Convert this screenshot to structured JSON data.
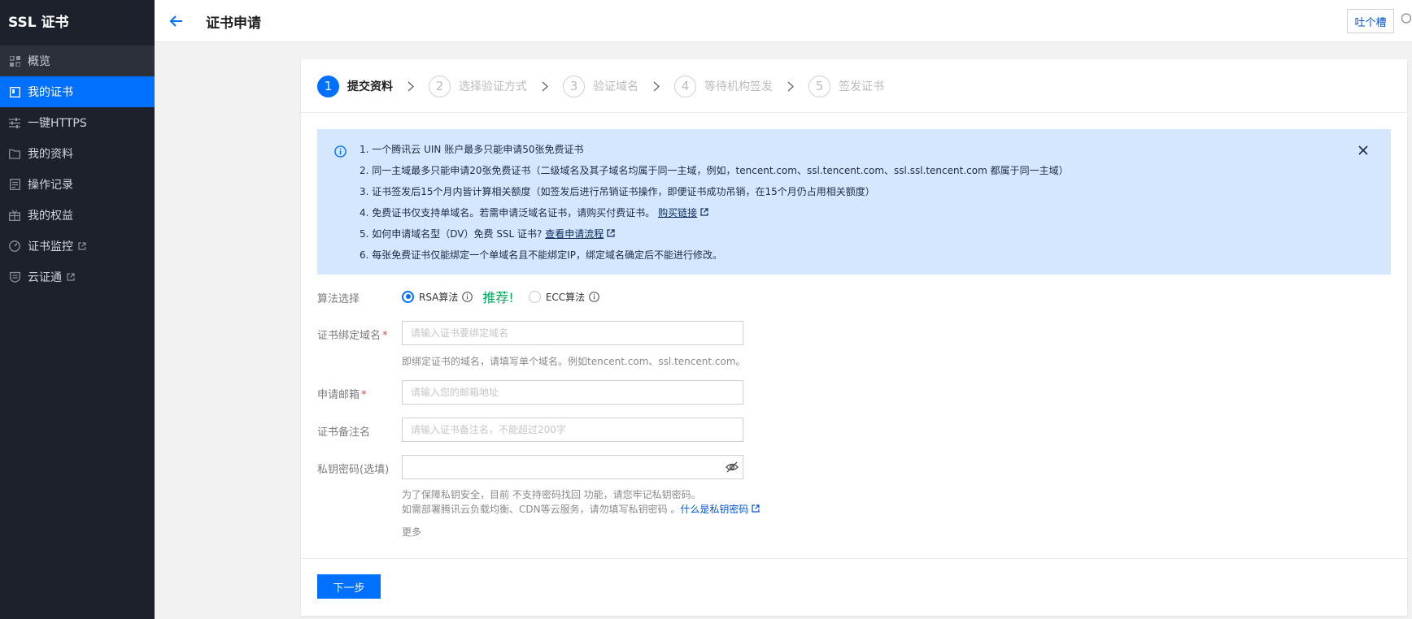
{
  "sidebar": {
    "brand": "SSL 证书",
    "items": [
      {
        "label": "概览",
        "icon": "grid-icon"
      },
      {
        "label": "我的证书",
        "icon": "certificate-icon"
      },
      {
        "label": "一键HTTPS",
        "icon": "sliders-icon"
      },
      {
        "label": "我的资料",
        "icon": "folder-icon"
      },
      {
        "label": "操作记录",
        "icon": "document-icon"
      },
      {
        "label": "我的权益",
        "icon": "gift-icon"
      },
      {
        "label": "证书监控",
        "icon": "gauge-icon",
        "external": true
      },
      {
        "label": "云证通",
        "icon": "shield-icon",
        "external": true
      }
    ]
  },
  "header": {
    "title": "证书申请",
    "feedback_label": "吐个槽"
  },
  "steps": [
    {
      "num": "1",
      "label": "提交资料",
      "active": true
    },
    {
      "num": "2",
      "label": "选择验证方式",
      "active": false
    },
    {
      "num": "3",
      "label": "验证域名",
      "active": false
    },
    {
      "num": "4",
      "label": "等待机构签发",
      "active": false
    },
    {
      "num": "5",
      "label": "签发证书",
      "active": false
    }
  ],
  "alert": {
    "line1": "1. 一个腾讯云 UIN 账户最多只能申请50张免费证书",
    "line2": "2. 同一主域最多只能申请20张免费证书（二级域名及其子域名均属于同一主域，例如，tencent.com、ssl.tencent.com、ssl.ssl.tencent.com 都属于同一主域）",
    "line3": "3. 证书签发后15个月内皆计算相关额度（如签发后进行吊销证书操作，即便证书成功吊销，在15个月仍占用相关额度）",
    "line4": "4. 免费证书仅支持单域名。若需申请泛域名证书，请购买付费证书。",
    "line4_link": "购买链接",
    "line5": "5. 如何申请域名型（DV）免费 SSL 证书?",
    "line5_link": "查看申请流程",
    "line6": "6. 每张免费证书仅能绑定一个单域名且不能绑定IP，绑定域名确定后不能进行修改。"
  },
  "form": {
    "algorithm_label": "算法选择",
    "rsa_label": "RSA算法",
    "recommend": "推荐!",
    "ecc_label": "ECC算法",
    "domain_label": "证书绑定域名",
    "domain_placeholder": "请输入证书要绑定域名",
    "domain_hint": "即绑定证书的域名，请填写单个域名。例如tencent.com、ssl.tencent.com。",
    "email_label": "申请邮箱",
    "email_placeholder": "请输入您的邮箱地址",
    "remark_label": "证书备注名",
    "remark_placeholder": "请输入证书备注名，不能超过200字",
    "password_label": "私钥密码(选填)",
    "password_placeholder": "",
    "password_hint1": "为了保障私钥安全，目前 不支持密码找回 功能，请您牢记私钥密码。",
    "password_hint2": "如需部署腾讯云负载均衡、CDN等云服务，请勿填写私钥密码 。",
    "password_link": "什么是私钥密码",
    "more_label": "更多",
    "next_label": "下一步",
    "required_mark": "*"
  },
  "colors": {
    "primary": "#0070ff",
    "sidebar_bg": "#1c212b",
    "alert_bg": "#d5e7fe",
    "recommend": "#00a65a"
  }
}
